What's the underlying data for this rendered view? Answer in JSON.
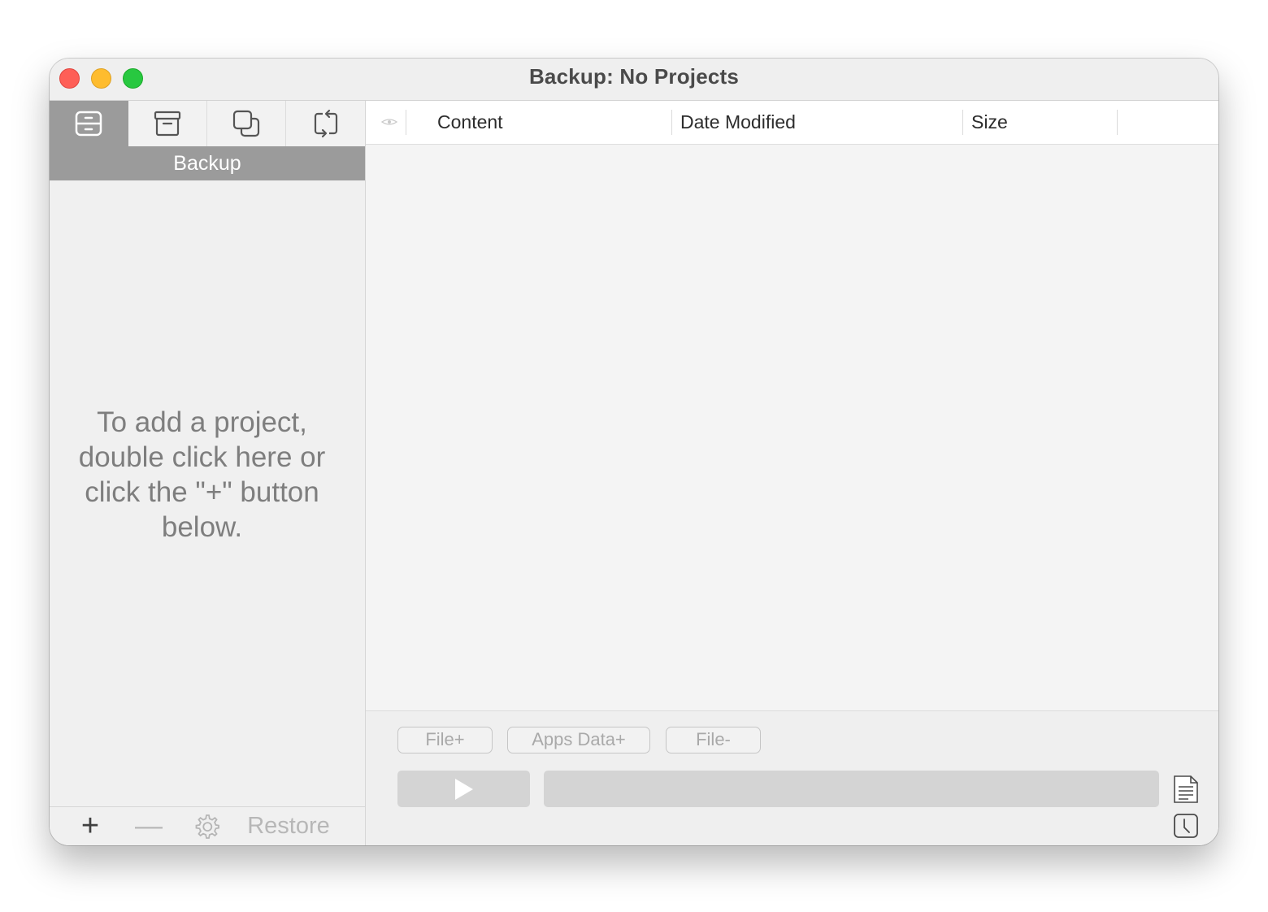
{
  "window": {
    "title": "Backup: No Projects"
  },
  "sidebar": {
    "tabs": [
      {
        "icon": "backup-drive-icon",
        "active": true
      },
      {
        "icon": "archive-box-icon",
        "active": false
      },
      {
        "icon": "clone-squares-icon",
        "active": false
      },
      {
        "icon": "sync-arrows-icon",
        "active": false
      }
    ],
    "active_tab_label": "Backup",
    "empty_hint": "To add a project, double click here or click the \"+\" button below.",
    "bottom": {
      "add_label": "+",
      "remove_label": "—",
      "settings_icon": "gear-icon",
      "restore_label": "Restore"
    }
  },
  "table": {
    "columns": [
      "Content",
      "Date Modified",
      "Size"
    ],
    "rows": []
  },
  "actions": {
    "file_add_label": "File+",
    "apps_data_add_label": "Apps Data+",
    "file_remove_label": "File-",
    "play_icon": "play-icon",
    "log_icon": "log-document-icon",
    "history_icon": "clock-icon"
  },
  "colors": {
    "close": "#fe5f57",
    "minimize": "#febc2e",
    "maximize": "#28c840",
    "active_tab": "#9b9b9b"
  }
}
